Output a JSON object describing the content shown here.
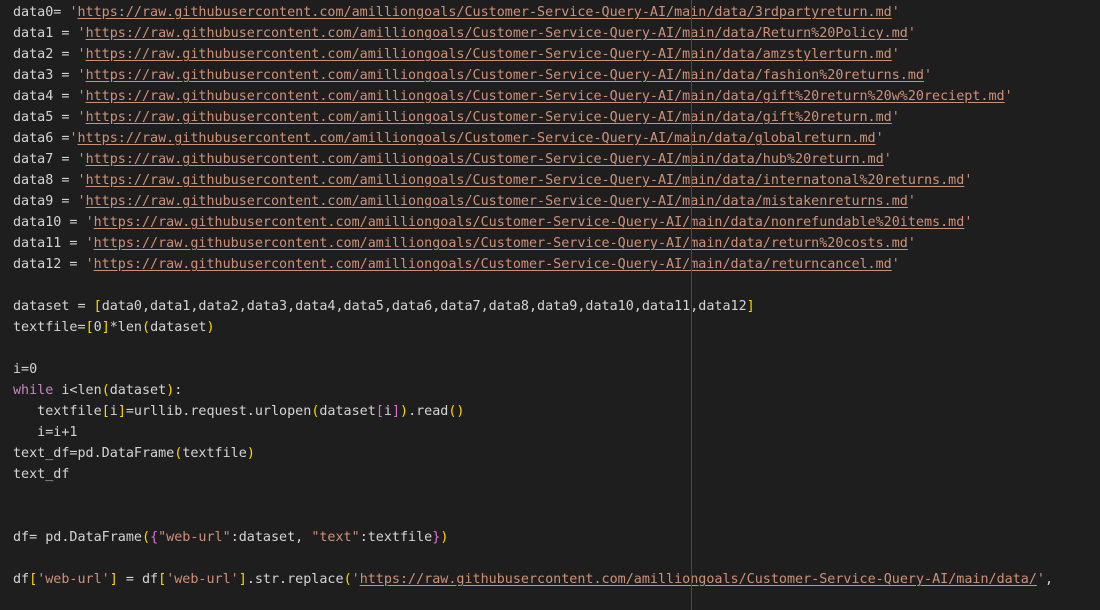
{
  "editor": {
    "colors": {
      "background": "#1e1e1e",
      "text": "#d4d4d4",
      "string": "#ce9178",
      "keyword": "#c586c0",
      "bracket_gold": "#ffd700",
      "bracket_orchid": "#da70d6",
      "bracket_blue": "#179fff",
      "ruler": "#4a4a4a"
    },
    "lines": [
      [
        {
          "t": "data0= ",
          "c": "var"
        },
        {
          "t": "'",
          "c": "str"
        },
        {
          "t": "https://raw.githubusercontent.com/amilliongoals/Customer-Service-Query-AI/main/data/3rdpartyreturn.md",
          "c": "url"
        },
        {
          "t": "'",
          "c": "str"
        }
      ],
      [
        {
          "t": "data1 = ",
          "c": "var"
        },
        {
          "t": "'",
          "c": "str"
        },
        {
          "t": "https://raw.githubusercontent.com/amilliongoals/Customer-Service-Query-AI/main/data/Return%20Policy.md",
          "c": "url"
        },
        {
          "t": "'",
          "c": "str"
        }
      ],
      [
        {
          "t": "data2 = ",
          "c": "var"
        },
        {
          "t": "'",
          "c": "str"
        },
        {
          "t": "https://raw.githubusercontent.com/amilliongoals/Customer-Service-Query-AI/main/data/amzstylerturn.md",
          "c": "url"
        },
        {
          "t": "'",
          "c": "str"
        }
      ],
      [
        {
          "t": "data3 = ",
          "c": "var"
        },
        {
          "t": "'",
          "c": "str"
        },
        {
          "t": "https://raw.githubusercontent.com/amilliongoals/Customer-Service-Query-AI/main/data/fashion%20returns.md",
          "c": "url"
        },
        {
          "t": "'",
          "c": "str"
        }
      ],
      [
        {
          "t": "data4 = ",
          "c": "var"
        },
        {
          "t": "'",
          "c": "str"
        },
        {
          "t": "https://raw.githubusercontent.com/amilliongoals/Customer-Service-Query-AI/main/data/gift%20return%20w%20reciept.md",
          "c": "url"
        },
        {
          "t": "'",
          "c": "str"
        }
      ],
      [
        {
          "t": "data5 = ",
          "c": "var"
        },
        {
          "t": "'",
          "c": "str"
        },
        {
          "t": "https://raw.githubusercontent.com/amilliongoals/Customer-Service-Query-AI/main/data/gift%20return.md",
          "c": "url"
        },
        {
          "t": "'",
          "c": "str"
        }
      ],
      [
        {
          "t": "data6 =",
          "c": "var"
        },
        {
          "t": "'",
          "c": "str"
        },
        {
          "t": "https://raw.githubusercontent.com/amilliongoals/Customer-Service-Query-AI/main/data/globalreturn.md",
          "c": "url"
        },
        {
          "t": "'",
          "c": "str"
        }
      ],
      [
        {
          "t": "data7 = ",
          "c": "var"
        },
        {
          "t": "'",
          "c": "str"
        },
        {
          "t": "https://raw.githubusercontent.com/amilliongoals/Customer-Service-Query-AI/main/data/hub%20return.md",
          "c": "url"
        },
        {
          "t": "'",
          "c": "str"
        }
      ],
      [
        {
          "t": "data8 = ",
          "c": "var"
        },
        {
          "t": "'",
          "c": "str"
        },
        {
          "t": "https://raw.githubusercontent.com/amilliongoals/Customer-Service-Query-AI/main/data/internatonal%20returns.md",
          "c": "url"
        },
        {
          "t": "'",
          "c": "str"
        }
      ],
      [
        {
          "t": "data9 = ",
          "c": "var"
        },
        {
          "t": "'",
          "c": "str"
        },
        {
          "t": "https://raw.githubusercontent.com/amilliongoals/Customer-Service-Query-AI/main/data/mistakenreturns.md",
          "c": "url"
        },
        {
          "t": "'",
          "c": "str"
        }
      ],
      [
        {
          "t": "data10 = ",
          "c": "var"
        },
        {
          "t": "'",
          "c": "str"
        },
        {
          "t": "https://raw.githubusercontent.com/amilliongoals/Customer-Service-Query-AI/main/data/nonrefundable%20items.md",
          "c": "url"
        },
        {
          "t": "'",
          "c": "str"
        }
      ],
      [
        {
          "t": "data11 = ",
          "c": "var"
        },
        {
          "t": "'",
          "c": "str"
        },
        {
          "t": "https://raw.githubusercontent.com/amilliongoals/Customer-Service-Query-AI/main/data/return%20costs.md",
          "c": "url"
        },
        {
          "t": "'",
          "c": "str"
        }
      ],
      [
        {
          "t": "data12 = ",
          "c": "var"
        },
        {
          "t": "'",
          "c": "str"
        },
        {
          "t": "https://raw.githubusercontent.com/amilliongoals/Customer-Service-Query-AI/main/data/returncancel.md",
          "c": "url"
        },
        {
          "t": "'",
          "c": "str"
        }
      ],
      [],
      [
        {
          "t": "dataset = ",
          "c": "var"
        },
        {
          "t": "[",
          "c": "br1"
        },
        {
          "t": "data0,data1,data2,data3,data4,data5,data6,data7,data8,data9,data10,data11,data12",
          "c": "var"
        },
        {
          "t": "]",
          "c": "br1"
        }
      ],
      [
        {
          "t": "textfile=",
          "c": "var"
        },
        {
          "t": "[",
          "c": "br1"
        },
        {
          "t": "0",
          "c": "var"
        },
        {
          "t": "]",
          "c": "br1"
        },
        {
          "t": "*len",
          "c": "var"
        },
        {
          "t": "(",
          "c": "br1"
        },
        {
          "t": "dataset",
          "c": "var"
        },
        {
          "t": ")",
          "c": "br1"
        }
      ],
      [],
      [
        {
          "t": "i=0",
          "c": "var"
        }
      ],
      [
        {
          "t": "while",
          "c": "kw"
        },
        {
          "t": " i<len",
          "c": "var"
        },
        {
          "t": "(",
          "c": "br1"
        },
        {
          "t": "dataset",
          "c": "var"
        },
        {
          "t": ")",
          "c": "br1"
        },
        {
          "t": ":",
          "c": "var"
        }
      ],
      [
        {
          "t": "   textfile",
          "c": "var"
        },
        {
          "t": "[",
          "c": "br1"
        },
        {
          "t": "i",
          "c": "var"
        },
        {
          "t": "]",
          "c": "br1"
        },
        {
          "t": "=urllib.request.urlopen",
          "c": "var"
        },
        {
          "t": "(",
          "c": "br1"
        },
        {
          "t": "dataset",
          "c": "var"
        },
        {
          "t": "[",
          "c": "br2"
        },
        {
          "t": "i",
          "c": "var"
        },
        {
          "t": "]",
          "c": "br2"
        },
        {
          "t": ")",
          "c": "br1"
        },
        {
          "t": ".read",
          "c": "var"
        },
        {
          "t": "()",
          "c": "br1"
        }
      ],
      [
        {
          "t": "   i=i+1",
          "c": "var"
        }
      ],
      [
        {
          "t": "text_df=pd.DataFrame",
          "c": "var"
        },
        {
          "t": "(",
          "c": "br1"
        },
        {
          "t": "textfile",
          "c": "var"
        },
        {
          "t": ")",
          "c": "br1"
        }
      ],
      [
        {
          "t": "text_df",
          "c": "var"
        }
      ],
      [],
      [],
      [
        {
          "t": "df= pd.DataFrame",
          "c": "var"
        },
        {
          "t": "(",
          "c": "br1"
        },
        {
          "t": "{",
          "c": "br2"
        },
        {
          "t": "\"web-url\"",
          "c": "str"
        },
        {
          "t": ":dataset, ",
          "c": "var"
        },
        {
          "t": "\"text\"",
          "c": "str"
        },
        {
          "t": ":textfile",
          "c": "var"
        },
        {
          "t": "}",
          "c": "br2"
        },
        {
          "t": ")",
          "c": "br1"
        }
      ],
      [],
      [
        {
          "t": "df",
          "c": "var"
        },
        {
          "t": "[",
          "c": "br1"
        },
        {
          "t": "'web-url'",
          "c": "str"
        },
        {
          "t": "]",
          "c": "br1"
        },
        {
          "t": " = df",
          "c": "var"
        },
        {
          "t": "[",
          "c": "br1"
        },
        {
          "t": "'web-url'",
          "c": "str"
        },
        {
          "t": "]",
          "c": "br1"
        },
        {
          "t": ".str.replace",
          "c": "var"
        },
        {
          "t": "(",
          "c": "br1"
        },
        {
          "t": "'",
          "c": "str"
        },
        {
          "t": "https://raw.githubusercontent.com/amilliongoals/Customer-Service-Query-AI/main/data/",
          "c": "url"
        },
        {
          "t": "'",
          "c": "str"
        },
        {
          "t": ",",
          "c": "var"
        }
      ]
    ]
  }
}
